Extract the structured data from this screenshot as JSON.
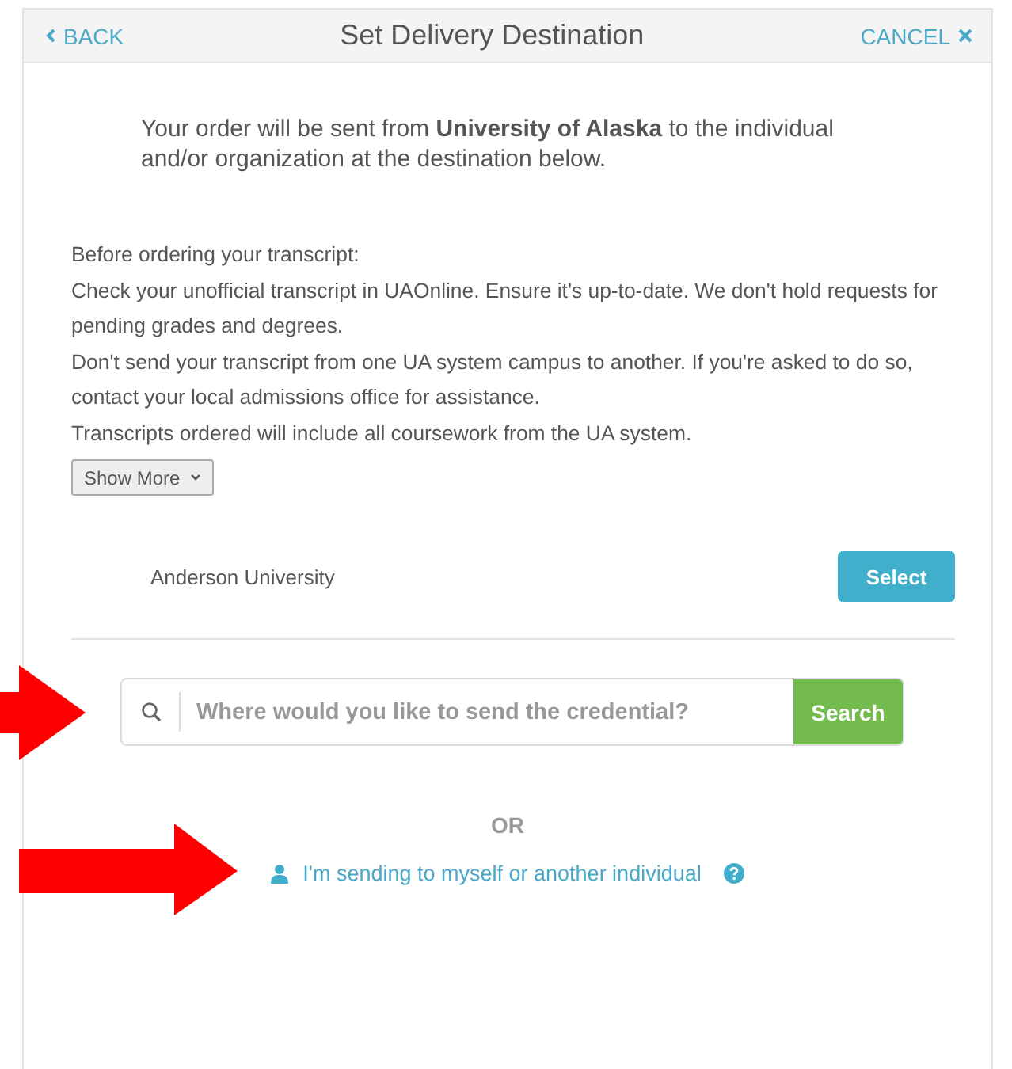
{
  "header": {
    "back": "BACK",
    "title": "Set Delivery Destination",
    "cancel": "CANCEL"
  },
  "intro": "Your order will be sent from **University of Alaska** to the individual and/or organization at the destination below.",
  "notes": [
    "Before ordering your transcript:",
    "Check your unofficial transcript in UAOnline. Ensure it's up-to-date. We don't hold requests for pending grades and degrees.",
    "Don't send your transcript from one UA system campus to another. If you're asked to do so, contact your local admissions office for assistance.",
    "Transcripts ordered will include all coursework from the UA system."
  ],
  "show_more": "Show More",
  "suggestion": {
    "name": "Anderson University",
    "button": "Select"
  },
  "search": {
    "placeholder": "Where would you like to send the credential?",
    "button": "Search"
  },
  "or": "OR",
  "individual_link": "I'm sending to myself or another individual"
}
